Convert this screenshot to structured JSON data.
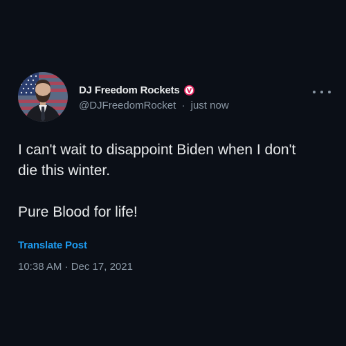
{
  "post": {
    "author": {
      "display_name": "DJ Freedom Rockets",
      "handle": "@DJFreedomRocket",
      "relative_time": "just now",
      "separator": "·",
      "badge_icon": "verified-badge-icon",
      "badge_color": "#e0245e"
    },
    "text": "I can't wait to disappoint Biden when I don't\ndie this winter.\n\nPure Blood for life!",
    "translate_label": "Translate Post",
    "timestamp": "10:38 AM · Dec 17, 2021",
    "more_icon": "more-horizontal-icon"
  },
  "colors": {
    "background": "#0b0f17",
    "primary_text": "#e7e9ea",
    "secondary_text": "#8b98a5",
    "link": "#1d9bf0"
  }
}
